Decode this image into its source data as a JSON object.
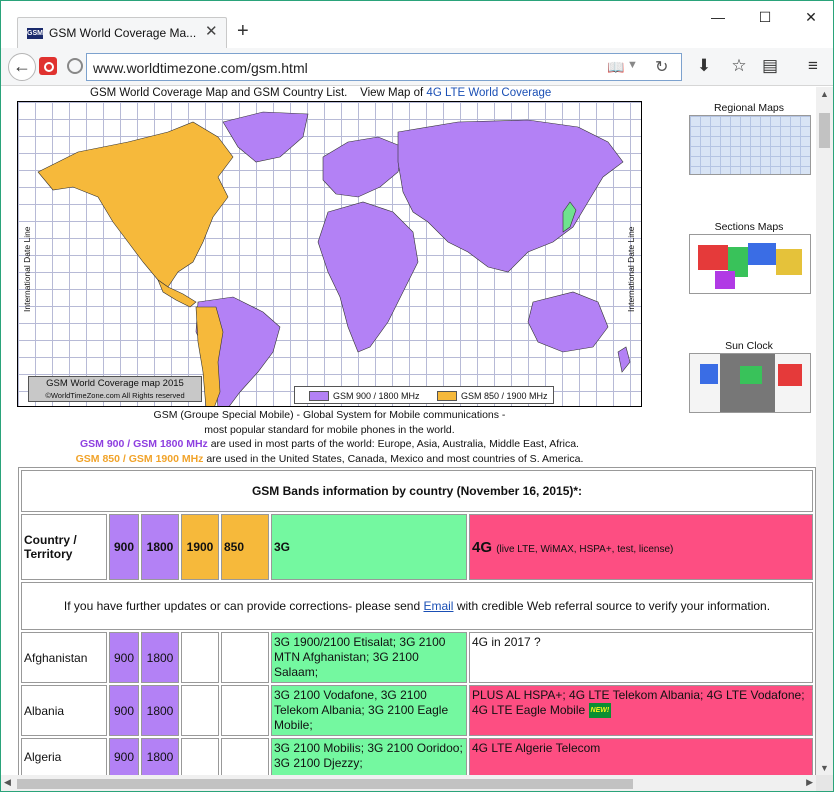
{
  "browser": {
    "tab_title": "GSM World Coverage Ma...",
    "favicon_text": "GSM",
    "url": "www.worldtimezone.com/gsm.html"
  },
  "page": {
    "top_text": "GSM World Coverage Map and GSM Country List.",
    "view_map_text": "View Map of",
    "view_map_link": "4G LTE World Coverage",
    "map": {
      "intl_date_line": "International Date Line",
      "caption_line1": "GSM World Coverage map 2015",
      "caption_line2": "©WorldTimeZone.com All Rights reserved",
      "legend_900": "GSM 900 / 1800 MHz",
      "legend_850": "GSM 850 / 1900 MHz",
      "color_900": "#b381f5",
      "color_850": "#f6b93b"
    },
    "sidebar": {
      "regional": "Regional Maps",
      "sections": "Sections Maps",
      "sunclock": "Sun Clock"
    },
    "desc": {
      "line1_bold": "GSM (Groupe Special Mobile)",
      "line1_rest": " - Global System for Mobile communications -",
      "line2": "most popular standard for mobile phones in the world.",
      "line3_bold": "GSM 900 / GSM 1800 MHz",
      "line3_rest": " are used in most parts of the world: Europe, Asia, Australia, Middle East, Africa.",
      "line4_bold": "GSM 850 / GSM 1900 MHz",
      "line4_rest": " are used in the United States, Canada, Mexico and most countries of S. America."
    },
    "table": {
      "title": "GSM Bands information by country (November 16, 2015)*:",
      "hdr_country": "Country / Territory",
      "hdr_900": "900",
      "hdr_1800": "1800",
      "hdr_1900": "1900",
      "hdr_850": "850",
      "hdr_3g": "3G",
      "hdr_4g": "4G",
      "hdr_4g_note": "(live LTE, WiMAX, HSPA+, test, license)",
      "notice_pre": "If you have further updates or can provide corrections- please send ",
      "notice_link": "Email",
      "notice_post": " with credible Web referral source to verify your information.",
      "rows": [
        {
          "country": "Afghanistan",
          "b900": "900",
          "b1800": "1800",
          "g3": "3G 1900/2100 Etisalat; 3G 2100 MTN Afghanistan; 3G 2100 Salaam;",
          "g4": "4G in 2017 ?"
        },
        {
          "country": "Albania",
          "b900": "900",
          "b1800": "1800",
          "g3": "3G 2100 Vodafone, 3G 2100 Telekom Albania; 3G 2100 Eagle Mobile;",
          "g4": "PLUS AL HSPA+; 4G LTE Telekom Albania; 4G LTE Vodafone; 4G LTE Eagle Mobile",
          "g4_badge": "NEW!"
        },
        {
          "country": "Algeria",
          "b900": "900",
          "b1800": "1800",
          "g3": "3G 2100 Mobilis; 3G 2100 Ooridoo; 3G 2100 Djezzy;",
          "g4": "4G LTE Algerie Telecom"
        }
      ]
    }
  }
}
